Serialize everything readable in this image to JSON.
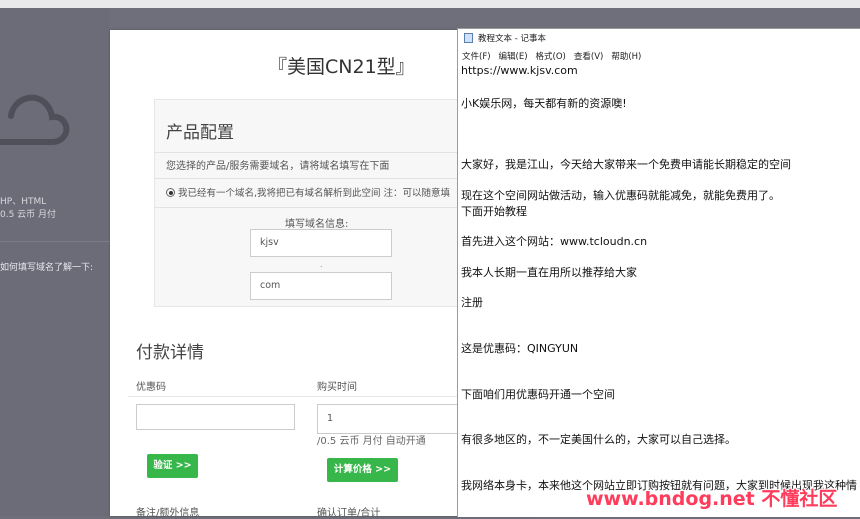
{
  "background_page": {
    "left_panel": {
      "product_line1": "HP、HTML",
      "product_line2": "0.5 云币 月付",
      "hint": "如何填写域名了解一下:"
    },
    "product_title": "『美国CN21型』",
    "config": {
      "heading": "产品配置",
      "desc": "您选择的产品/服务需要域名，请将域名填写在下面",
      "radio_label": "我已经有一个域名,我将把已有域名解析到此空间 注：可以随意填",
      "domain_info_label": "填写域名信息:",
      "domain_name_value": "kjsv",
      "dot_separator": ".",
      "domain_suffix_value": "com"
    },
    "payment": {
      "heading": "付款详情",
      "coupon_label": "优惠码",
      "coupon_value": "",
      "purchase_time_label": "购买时间",
      "purchase_time_value": "1",
      "price_note": "/0.5 云币 月付 自动开通",
      "verify_button": "验证 >>",
      "calc_price_button": "计算价格 >>",
      "notes_label": "备注/额外信息",
      "confirm_label": "确认订单/合计"
    }
  },
  "notepad": {
    "window_title": "教程文本 - 记事本",
    "menu": [
      "文件(F)",
      "编辑(E)",
      "格式(O)",
      "查看(V)",
      "帮助(H)"
    ],
    "lines": [
      "https://www.kjsv.com",
      "小K娱乐网，每天都有新的资源噢!",
      "大家好，我是江山，今天给大家带来一个免费申请能长期稳定的空间",
      "现在这个空间网站做活动，输入优惠码就能减免，就能免费用了。",
      "下面开始教程",
      "首先进入这个网站：www.tcloudn.cn",
      "我本人长期一直在用所以推荐给大家",
      "注册",
      "这是优惠码：QINGYUN",
      "下面咱们用优惠码开通一个空间",
      "有很多地区的，不一定美国什么的，大家可以自己选择。",
      "我网络本身卡，本来他这个网站立即订购按钮就有问题，大家到时候出现我这种情"
    ]
  },
  "watermark": "www.bndog.net 不懂社区",
  "colors": {
    "accent_green": "#37b64a",
    "watermark_red": "#ff3c5c",
    "dimmed_overlay": "#6f6f7b"
  },
  "icons": {
    "cloud": "cloud-icon",
    "notepad": "notepad-icon",
    "radio": "radio-selected-icon"
  }
}
